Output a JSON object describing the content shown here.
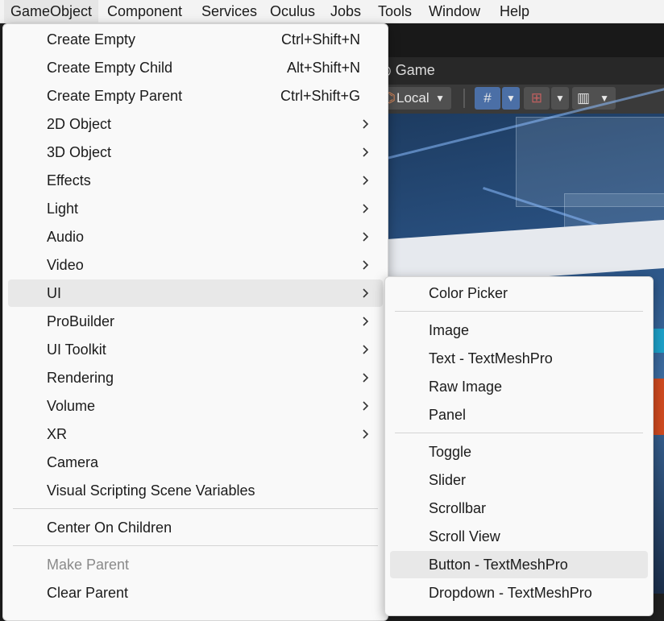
{
  "menubar": {
    "items": [
      "GameObject",
      "Component",
      "Services",
      "Oculus",
      "Jobs",
      "Tools",
      "Window",
      "Help"
    ]
  },
  "editor": {
    "game_tab": "Game",
    "pivot_rotation": "Local"
  },
  "main_menu": {
    "items": [
      {
        "label": "Create Empty",
        "shortcut": "Ctrl+Shift+N"
      },
      {
        "label": "Create Empty Child",
        "shortcut": "Alt+Shift+N"
      },
      {
        "label": "Create Empty Parent",
        "shortcut": "Ctrl+Shift+G"
      },
      {
        "label": "2D Object",
        "submenu": true
      },
      {
        "label": "3D Object",
        "submenu": true
      },
      {
        "label": "Effects",
        "submenu": true
      },
      {
        "label": "Light",
        "submenu": true
      },
      {
        "label": "Audio",
        "submenu": true
      },
      {
        "label": "Video",
        "submenu": true
      },
      {
        "label": "UI",
        "submenu": true,
        "highlighted": true
      },
      {
        "label": "ProBuilder",
        "submenu": true
      },
      {
        "label": "UI Toolkit",
        "submenu": true
      },
      {
        "label": "Rendering",
        "submenu": true
      },
      {
        "label": "Volume",
        "submenu": true
      },
      {
        "label": "XR",
        "submenu": true
      },
      {
        "label": "Camera"
      },
      {
        "label": "Visual Scripting Scene Variables"
      },
      {
        "label": "Center On Children"
      },
      {
        "label": "Make Parent",
        "disabled": true
      },
      {
        "label": "Clear Parent"
      }
    ]
  },
  "ui_submenu": {
    "items": [
      {
        "label": "Color Picker"
      },
      {
        "label": "Image"
      },
      {
        "label": "Text - TextMeshPro"
      },
      {
        "label": "Raw Image"
      },
      {
        "label": "Panel"
      },
      {
        "label": "Toggle"
      },
      {
        "label": "Slider"
      },
      {
        "label": "Scrollbar"
      },
      {
        "label": "Scroll View"
      },
      {
        "label": "Button - TextMeshPro",
        "highlighted": true
      },
      {
        "label": "Dropdown - TextMeshPro"
      }
    ]
  },
  "colors": {
    "menu_bg": "#f9f9f9",
    "highlight": "#e8e8e8",
    "toolbar_active": "#4b6fa6"
  }
}
